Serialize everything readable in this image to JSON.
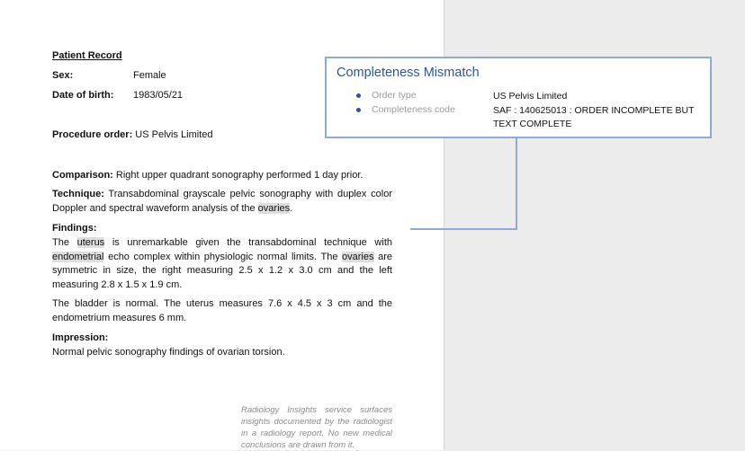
{
  "document": {
    "heading": "Patient Record",
    "sex_label": "Sex:",
    "sex_value": "Female",
    "dob_label": "Date of birth:",
    "dob_value": "1983/05/21",
    "procedure_label": "Procedure order:",
    "procedure_value": " US Pelvis Limited",
    "comparison_label": "Comparison:",
    "comparison_text": " Right upper quadrant sonography performed 1 day prior.",
    "technique_label": "Technique:",
    "technique_text": " Transabdominal grayscale pelvic sonography with duplex color Doppler and spectral waveform analysis of the ",
    "technique_hl": "ovaries",
    "technique_end": ".",
    "findings_label": "Findings:",
    "findings_p1_a": "The ",
    "findings_p1_hl1": "uterus",
    "findings_p1_b": " is unremarkable given the transabdominal technique with ",
    "findings_p1_hl2": "endometrial",
    "findings_p1_c": " echo complex within physiologic normal limits. The ",
    "findings_p1_hl3": "ovaries",
    "findings_p1_d": " are symmetric in size, the right measuring 2.5 x 1.2 x 3.0 cm and the left measuring 2.8 x 1.5 x 1.9 cm.",
    "findings_p2": "The bladder is normal. The uterus measures 7.6 x 4.5 x 3 cm and the endometrium measures 6 mm.",
    "impression_label": "Impression:",
    "impression_text": "Normal pelvic sonography findings of ovarian torsion.",
    "footer_note": "Radiology Insights service surfaces insights documented by the radiologist in a radiology report. No new medical conclusions are drawn from it."
  },
  "callout": {
    "title": "Completeness Mismatch",
    "rows": [
      {
        "label": "Order type",
        "value": "US Pelvis Limited"
      },
      {
        "label": "Completeness code",
        "value": "SAF : 140625013 : ORDER INCOMPLETE BUT TEXT COMPLETE"
      }
    ]
  },
  "colors": {
    "accent": "#2f5597",
    "callout_border": "#8eaadb",
    "highlight": "#dedede",
    "page_background": "#ececec"
  }
}
